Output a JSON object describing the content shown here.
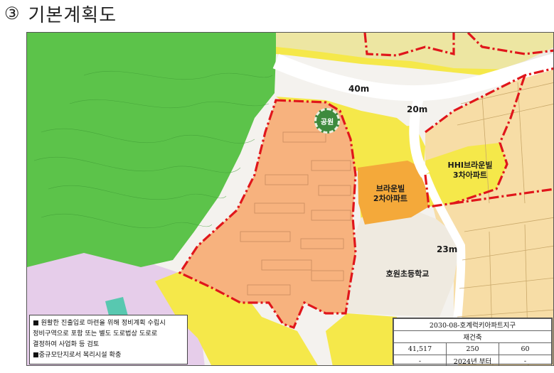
{
  "title": {
    "number": "③",
    "text": "기본계획도"
  },
  "map": {
    "road_labels": [
      "40m",
      "20m",
      "23m"
    ],
    "park_label": "공원",
    "places": {
      "hhi_line1": "HHI브라운빌",
      "hhi_line2": "3차아파트",
      "brownville_line1": "브라운빌",
      "brownville_line2": "2차아파트",
      "school": "호원초등학교"
    },
    "colors": {
      "forest": "#5cc34a",
      "project_area": "#f7b27e",
      "residential": "#f5e84a",
      "apartment_block": "#f7dda6",
      "brownville": "#f4a93a",
      "school": "#efeae0",
      "purple_zone": "#e6cdea",
      "road": "#ffffff",
      "boundary": "#e0161b"
    }
  },
  "notes": {
    "line1": "■ 원활한 진출입로 마련을 위해 정비계획 수립시",
    "line2": "정비구역으로 포함 또는 별도 도로법상 도로로",
    "line3": "결정하여 사업화 등 검토",
    "line4": "■중규모단지로서 복리시설 확충"
  },
  "info_table": {
    "title": "2030-08-호계럭키아파트지구",
    "subtitle": "재건축",
    "row1": [
      "41,517",
      "250",
      "60"
    ],
    "row2": [
      "-",
      "2024년 부터",
      "-"
    ]
  }
}
